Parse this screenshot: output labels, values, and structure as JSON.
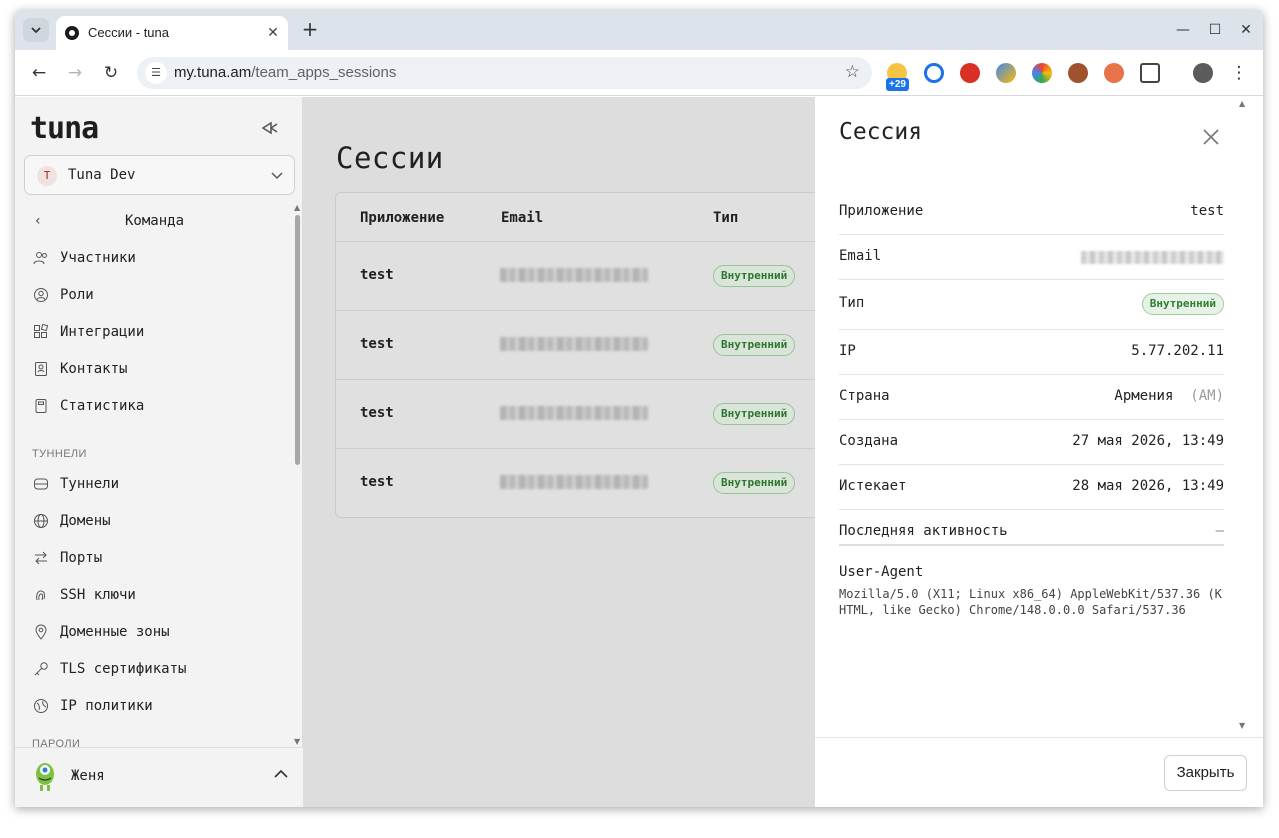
{
  "browser": {
    "tab_title": "Сессии - tuna",
    "url_host": "my.tuna.am",
    "url_path": "/team_apps_sessions",
    "extension_badge": "+29"
  },
  "sidebar": {
    "logo": "tuna",
    "team": {
      "initial": "T",
      "name": "Tuna Dev"
    },
    "back_label": "Команда",
    "items_team": [
      {
        "label": "Участники",
        "icon": "users-icon"
      },
      {
        "label": "Роли",
        "icon": "user-circle-icon"
      },
      {
        "label": "Интеграции",
        "icon": "integrations-icon"
      },
      {
        "label": "Контакты",
        "icon": "contacts-icon"
      },
      {
        "label": "Статистика",
        "icon": "statistics-icon"
      }
    ],
    "section_tunnels": "ТУННЕЛИ",
    "items_tunnels": [
      {
        "label": "Туннели",
        "icon": "tunnels-icon"
      },
      {
        "label": "Домены",
        "icon": "globe-icon"
      },
      {
        "label": "Порты",
        "icon": "ports-icon"
      },
      {
        "label": "SSH ключи",
        "icon": "fingerprint-icon"
      },
      {
        "label": "Доменные зоны",
        "icon": "location-icon"
      },
      {
        "label": "TLS сертификаты",
        "icon": "key-icon"
      },
      {
        "label": "IP политики",
        "icon": "ip-policy-icon"
      }
    ],
    "section_passwords": "ПАРОЛИ",
    "user_name": "Женя"
  },
  "main": {
    "title": "Сессии",
    "table": {
      "headers": [
        "Приложение",
        "Email",
        "Тип"
      ],
      "rows": [
        {
          "app": "test",
          "type": "Внутренний"
        },
        {
          "app": "test",
          "type": "Внутренний"
        },
        {
          "app": "test",
          "type": "Внутренний"
        },
        {
          "app": "test",
          "type": "Внутренний"
        }
      ]
    }
  },
  "drawer": {
    "title": "Сессия",
    "fields": {
      "app_label": "Приложение",
      "app_value": "test",
      "email_label": "Email",
      "type_label": "Тип",
      "type_value": "Внутренний",
      "ip_label": "IP",
      "ip_value": "5.77.202.11",
      "country_label": "Страна",
      "country_value": "Армения",
      "country_code": "(AM)",
      "created_label": "Создана",
      "created_value": "27 мая 2026, 13:49",
      "expires_label": "Истекает",
      "expires_value": "28 мая 2026, 13:49",
      "activity_label": "Последняя активность",
      "activity_value": "—"
    },
    "user_agent_label": "User-Agent",
    "user_agent_value": "Mozilla/5.0 (X11; Linux x86_64) AppleWebKit/537.36 (KHTML, like Gecko) Chrome/148.0.0.0 Safari/537.36",
    "close_button": "Закрыть"
  }
}
